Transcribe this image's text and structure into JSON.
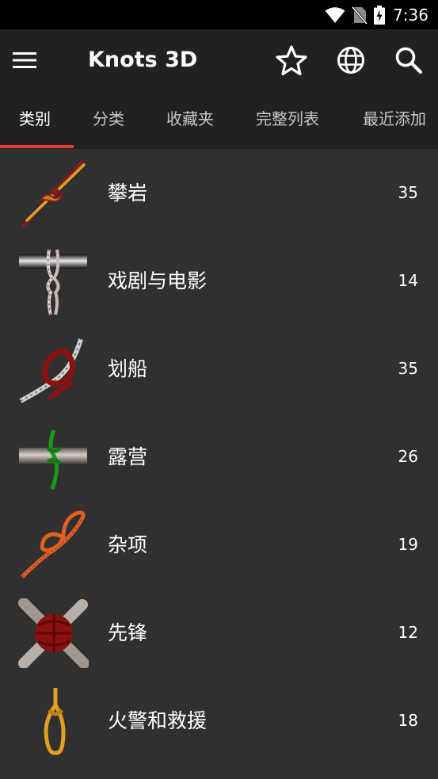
{
  "status_bar": {
    "time": "7:36"
  },
  "app_bar": {
    "title": "Knots 3D"
  },
  "tabs": [
    {
      "label": "类别"
    },
    {
      "label": "分类"
    },
    {
      "label": "收藏夹"
    },
    {
      "label": "完整列表"
    },
    {
      "label": "最近添加"
    }
  ],
  "categories": [
    {
      "label": "攀岩",
      "count": "35",
      "icon": "climbing-knot-icon"
    },
    {
      "label": "戏剧与电影",
      "count": "14",
      "icon": "theatre-knot-icon"
    },
    {
      "label": "划船",
      "count": "35",
      "icon": "boating-knot-icon"
    },
    {
      "label": "露营",
      "count": "26",
      "icon": "camping-knot-icon"
    },
    {
      "label": "杂项",
      "count": "19",
      "icon": "misc-knot-icon"
    },
    {
      "label": "先锋",
      "count": "12",
      "icon": "pioneering-knot-icon"
    },
    {
      "label": "火警和救援",
      "count": "18",
      "icon": "fire-rescue-knot-icon"
    }
  ],
  "colors": {
    "accent": "#e53935",
    "toolbar": "#212121",
    "background": "#303030"
  }
}
